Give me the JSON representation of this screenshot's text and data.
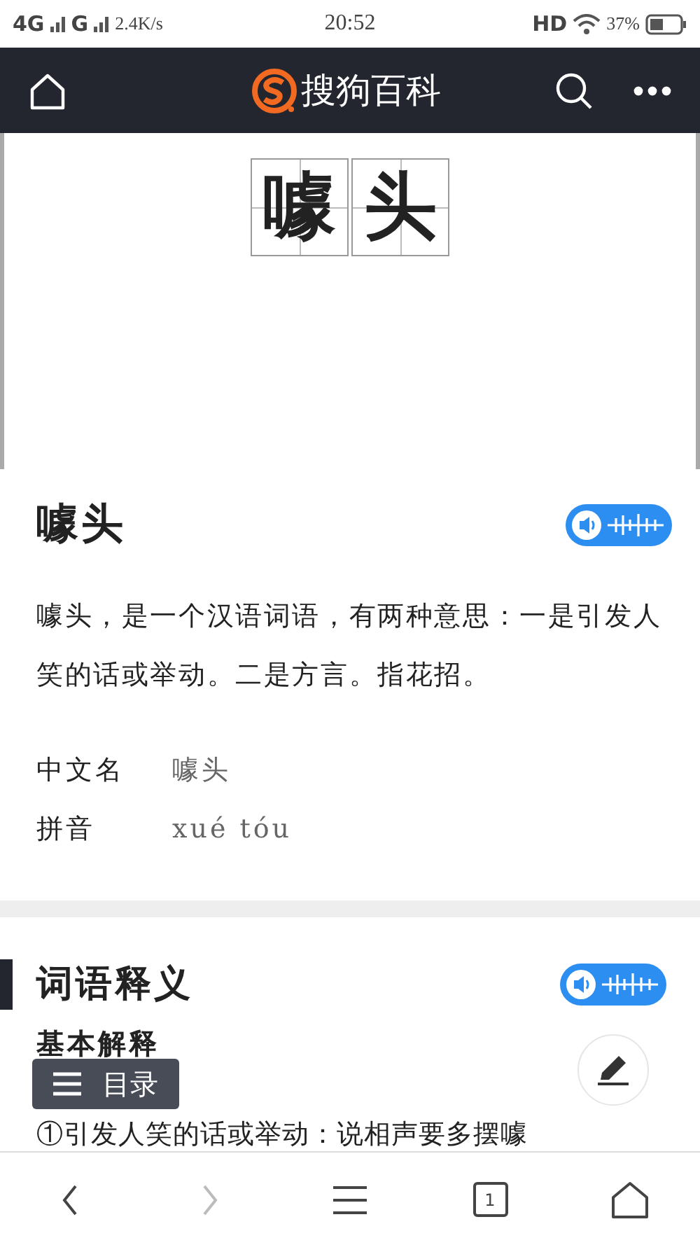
{
  "status_bar": {
    "network_1": "4G",
    "network_2": "G",
    "speed": "2.4K/s",
    "time": "20:52",
    "hd": "HD",
    "battery": "37%"
  },
  "nav_bar": {
    "brand": "搜狗百科"
  },
  "hanzi_grid": [
    "噱",
    "头"
  ],
  "entry": {
    "title": "噱头",
    "summary": "噱头，是一个汉语词语，有两种意思：一是引发人笑的话或举动。二是方言。指花招。",
    "facts": [
      {
        "label": "中文名",
        "value": "噱头"
      },
      {
        "label": "拼音",
        "value": "xué tóu"
      }
    ]
  },
  "section": {
    "title": "词语释义",
    "subtitle": "基本解释",
    "line": "①引发人笑的话或举动：说相声要多摆噱"
  },
  "toc_button": {
    "label": "目录"
  },
  "bottom_bar": [
    {
      "kind": "back",
      "disabled": false
    },
    {
      "kind": "forward",
      "disabled": true
    },
    {
      "kind": "menu",
      "disabled": false
    },
    {
      "kind": "tabs",
      "disabled": false,
      "count": "1"
    },
    {
      "kind": "home",
      "disabled": false
    }
  ]
}
